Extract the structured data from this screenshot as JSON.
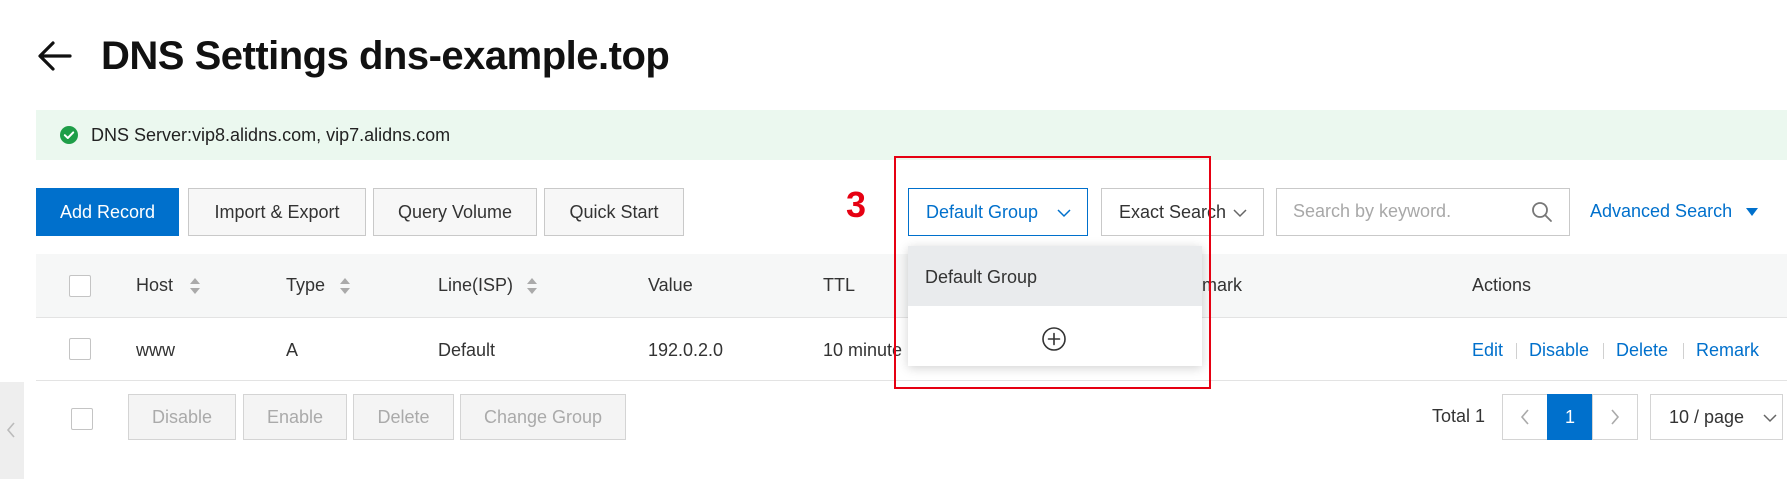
{
  "header": {
    "title": "DNS Settings dns-example.top"
  },
  "banner": {
    "text": "DNS Server:vip8.alidns.com, vip7.alidns.com"
  },
  "annotation": {
    "step_number": "3"
  },
  "toolbar": {
    "add_record": "Add Record",
    "import_export": "Import & Export",
    "query_volume": "Query Volume",
    "quick_start": "Quick Start",
    "group_select": "Default Group",
    "search_mode": "Exact Search",
    "search_placeholder": "Search by keyword.",
    "advanced_search": "Advanced Search"
  },
  "dropdown": {
    "options": [
      "Default Group"
    ]
  },
  "table": {
    "columns": {
      "host": "Host",
      "type": "Type",
      "line": "Line(ISP)",
      "value": "Value",
      "ttl": "TTL",
      "remark": "mark",
      "actions": "Actions"
    },
    "rows": [
      {
        "host": "www",
        "type": "A",
        "line": "Default",
        "value": "192.0.2.0",
        "ttl": "10 minute",
        "actions": [
          "Edit",
          "Disable",
          "Delete",
          "Remark"
        ]
      }
    ]
  },
  "footer": {
    "bulk": [
      "Disable",
      "Enable",
      "Delete",
      "Change Group"
    ],
    "total": "Total 1",
    "current_page": "1",
    "page_size": "10 / page"
  },
  "colors": {
    "primary": "#0070cc",
    "highlight": "#e60012",
    "success": "#1e9e48",
    "banner_bg": "#ebf8ef"
  }
}
